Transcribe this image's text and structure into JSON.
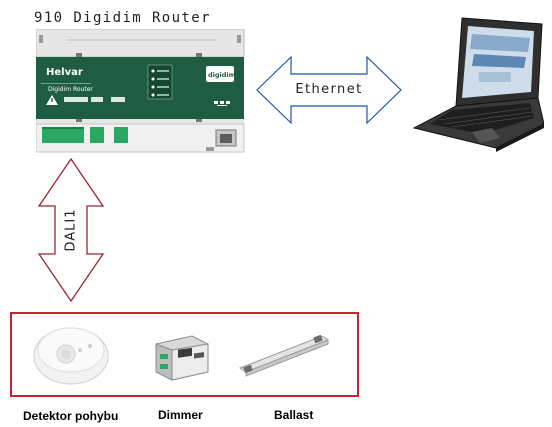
{
  "router": {
    "title": "910  Digidim  Router",
    "brand": "Helvar",
    "product_label": "Digidim Router",
    "logo": "digidim"
  },
  "links": {
    "ethernet": "Ethernet",
    "dali": "DALI1"
  },
  "devices": [
    {
      "label": "Detektor pohybu",
      "icon": "motion-detector-icon"
    },
    {
      "label": "Dimmer",
      "icon": "dimmer-icon"
    },
    {
      "label": "Ballast",
      "icon": "ballast-icon"
    }
  ],
  "colors": {
    "router_panel": "#1e5d43",
    "terminal_green": "#2aa760",
    "arrow_outline": "#9a2432",
    "group_border": "#c1272d"
  }
}
